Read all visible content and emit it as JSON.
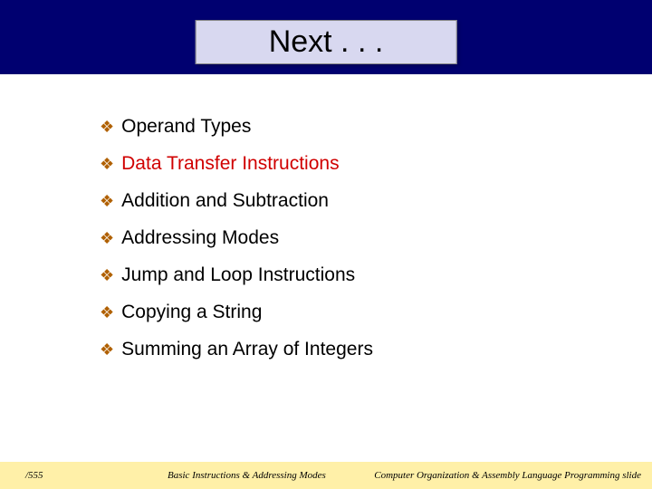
{
  "title": "Next . . .",
  "items": [
    {
      "label": "Operand Types",
      "highlight": false
    },
    {
      "label": "Data Transfer Instructions",
      "highlight": true
    },
    {
      "label": "Addition and Subtraction",
      "highlight": false
    },
    {
      "label": "Addressing Modes",
      "highlight": false
    },
    {
      "label": "Jump and Loop Instructions",
      "highlight": false
    },
    {
      "label": "Copying a String",
      "highlight": false
    },
    {
      "label": "Summing an Array of Integers",
      "highlight": false
    }
  ],
  "footer": {
    "left": "/555",
    "center": "Basic Instructions & Addressing Modes",
    "right": "Computer Organization & Assembly Language Programming slide"
  }
}
